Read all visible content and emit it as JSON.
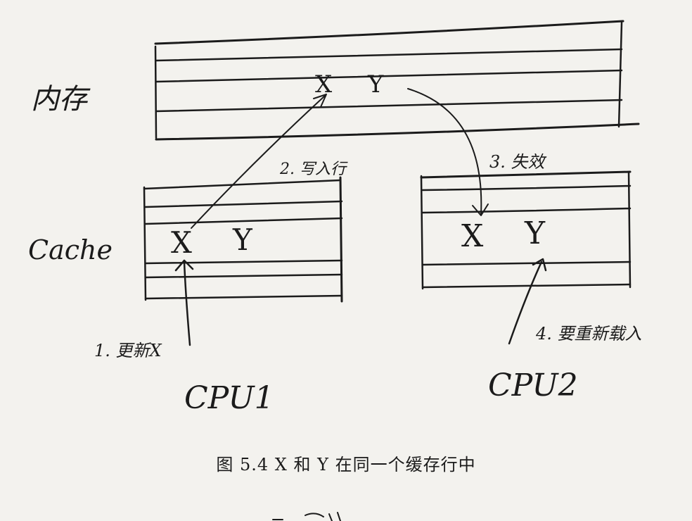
{
  "labels": {
    "memory": "内存",
    "cache": "Cache",
    "cpu1": "CPU1",
    "cpu2": "CPU2"
  },
  "memory_row": {
    "x": "X",
    "y": "Y"
  },
  "cache1_row": {
    "x": "X",
    "y": "Y"
  },
  "cache2_row": {
    "x": "X",
    "y": "Y"
  },
  "steps": [
    {
      "label": "1. 更新X"
    },
    {
      "label": "2. 写入行"
    },
    {
      "label": "3. 失效"
    },
    {
      "label": "4. 要重新载入"
    }
  ],
  "caption": "图 5.4   X 和 Y 在同一个缓存行中"
}
